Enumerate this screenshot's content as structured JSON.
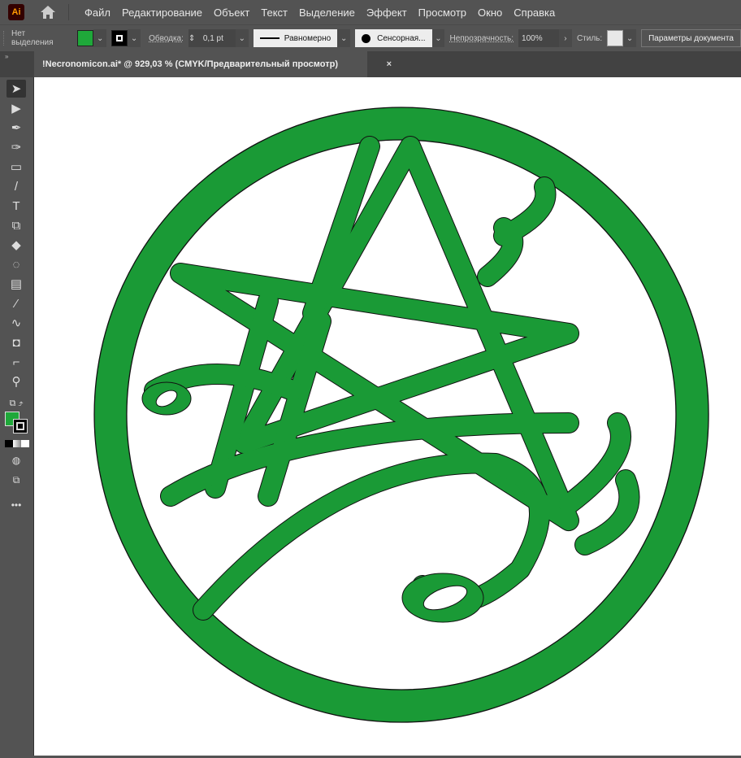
{
  "app": {
    "logo": "Ai"
  },
  "menu": [
    "Файл",
    "Редактирование",
    "Объект",
    "Текст",
    "Выделение",
    "Эффект",
    "Просмотр",
    "Окно",
    "Справка"
  ],
  "control": {
    "selection": "Нет выделения",
    "fill_color": "#1a9a36",
    "stroke_label": "Обводка:",
    "stroke_weight": "0,1 pt",
    "stroke_profile": "Равномерно",
    "brush": "Сенсорная...",
    "opacity_label": "Непрозрачность:",
    "opacity": "100%",
    "style_label": "Стиль:",
    "doc_settings": "Параметры документа"
  },
  "tab": {
    "title": "!Necronomicon.ai* @ 929,03 % (CMYK/Предварительный просмотр)",
    "close": "×"
  },
  "colors": {
    "artwork_green": "#1a9a36",
    "outline": "#111111"
  }
}
